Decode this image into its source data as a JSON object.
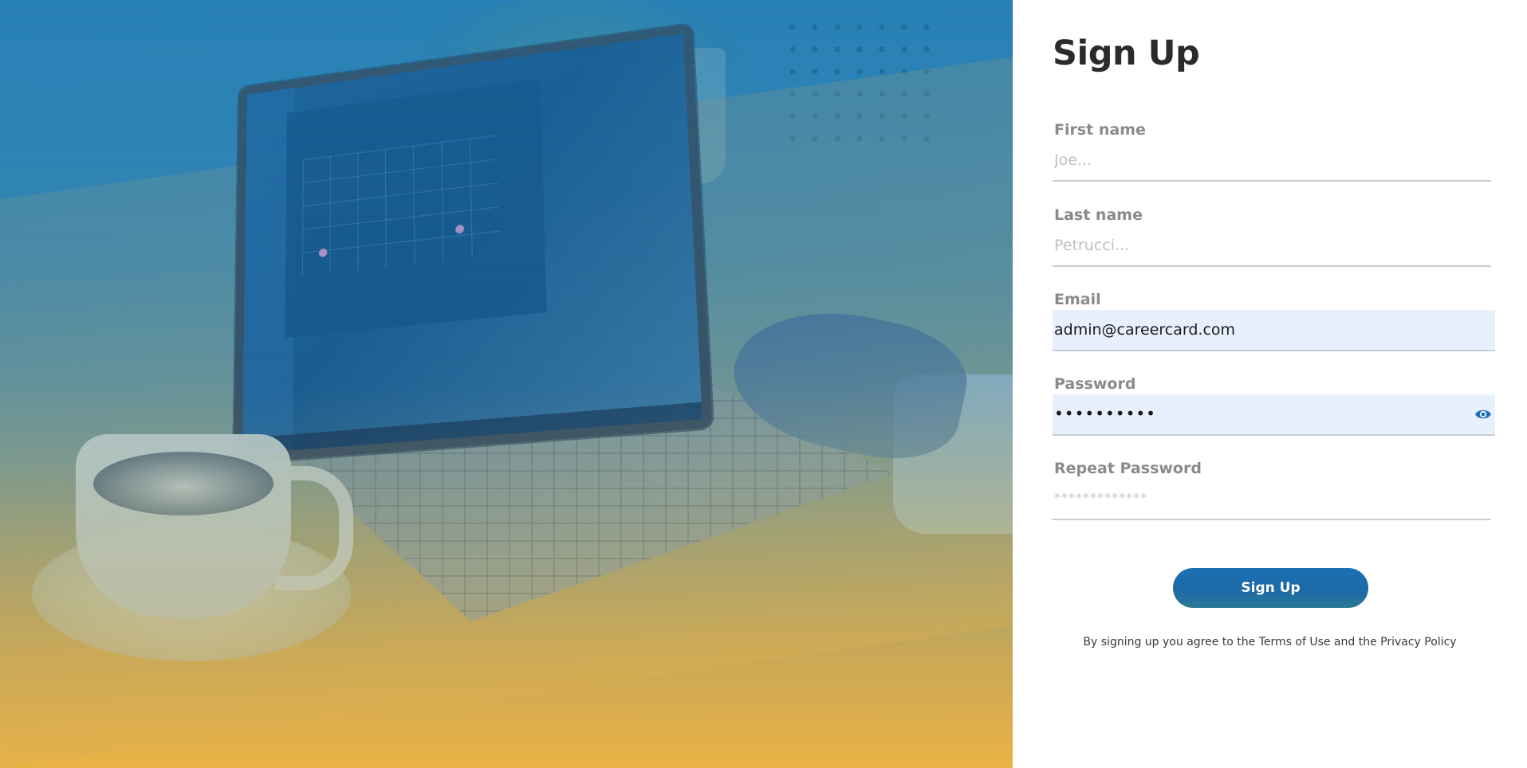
{
  "page": {
    "title": "Sign Up"
  },
  "form": {
    "first_name": {
      "label": "First name",
      "placeholder": "Joe...",
      "value": ""
    },
    "last_name": {
      "label": "Last name",
      "placeholder": "Petrucci...",
      "value": ""
    },
    "email": {
      "label": "Email",
      "placeholder": "",
      "value": "admin@careercard.com"
    },
    "password": {
      "label": "Password",
      "masked_value": "••••••••••"
    },
    "repeat_password": {
      "label": "Repeat Password",
      "placeholder": "*************"
    },
    "submit_label": "Sign Up",
    "terms_text": "By signing up you agree to the Terms of Use and the Privacy Policy"
  },
  "icons": {
    "password_toggle": "eye-icon"
  },
  "colors": {
    "primary": "#1a6fb5",
    "autofill_bg": "#e8f0fe",
    "label": "#8a8a8a",
    "title": "#2b2b2b"
  }
}
